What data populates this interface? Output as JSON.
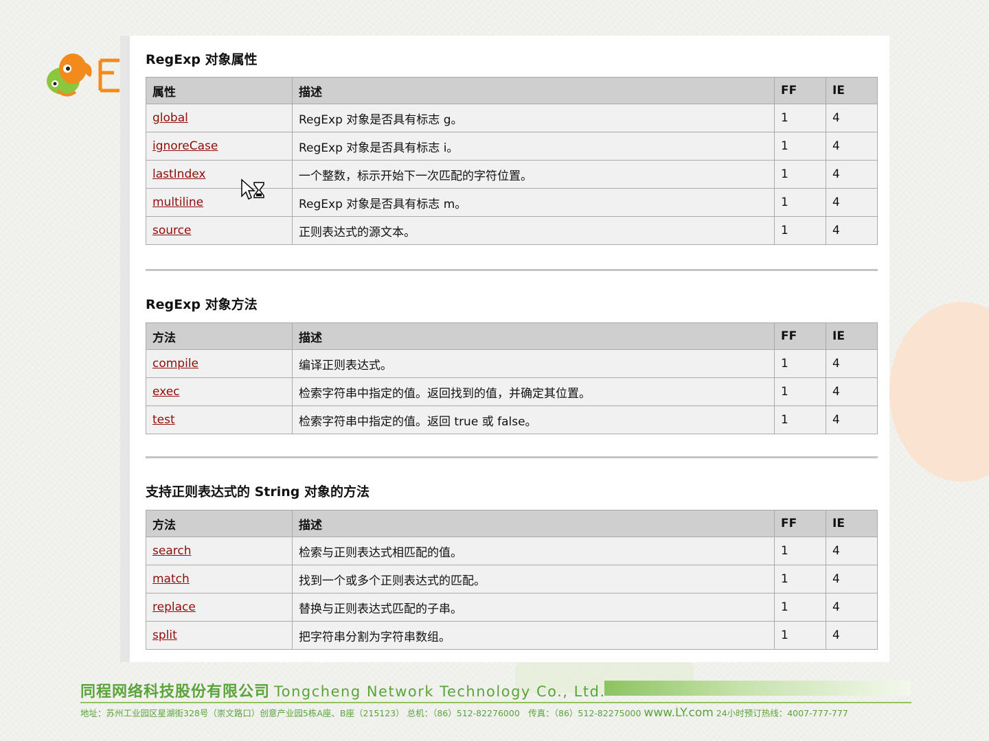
{
  "sections": [
    {
      "title": "RegExp 对象属性",
      "headers": [
        "属性",
        "描述",
        "FF",
        "IE"
      ],
      "rows": [
        {
          "name": "global",
          "desc": "RegExp 对象是否具有标志 g。",
          "ff": "1",
          "ie": "4"
        },
        {
          "name": "ignoreCase",
          "desc": "RegExp 对象是否具有标志 i。",
          "ff": "1",
          "ie": "4"
        },
        {
          "name": "lastIndex",
          "desc": "一个整数，标示开始下一次匹配的字符位置。",
          "ff": "1",
          "ie": "4"
        },
        {
          "name": "multiline",
          "desc": "RegExp 对象是否具有标志 m。",
          "ff": "1",
          "ie": "4"
        },
        {
          "name": "source",
          "desc": "正则表达式的源文本。",
          "ff": "1",
          "ie": "4"
        }
      ]
    },
    {
      "title": "RegExp 对象方法",
      "headers": [
        "方法",
        "描述",
        "FF",
        "IE"
      ],
      "rows": [
        {
          "name": "compile",
          "desc": "编译正则表达式。",
          "ff": "1",
          "ie": "4"
        },
        {
          "name": "exec",
          "desc": "检索字符串中指定的值。返回找到的值，并确定其位置。",
          "ff": "1",
          "ie": "4"
        },
        {
          "name": "test",
          "desc": "检索字符串中指定的值。返回 true 或 false。",
          "ff": "1",
          "ie": "4"
        }
      ]
    },
    {
      "title": "支持正则表达式的 String 对象的方法",
      "headers": [
        "方法",
        "描述",
        "FF",
        "IE"
      ],
      "rows": [
        {
          "name": "search",
          "desc": "检索与正则表达式相匹配的值。",
          "ff": "1",
          "ie": "4"
        },
        {
          "name": "match",
          "desc": "找到一个或多个正则表达式的匹配。",
          "ff": "1",
          "ie": "4"
        },
        {
          "name": "replace",
          "desc": "替换与正则表达式匹配的子串。",
          "ff": "1",
          "ie": "4"
        },
        {
          "name": "split",
          "desc": "把字符串分割为字符串数组。",
          "ff": "1",
          "ie": "4"
        }
      ]
    }
  ],
  "footer": {
    "company_cn": "同程网络科技股份有限公司",
    "company_en": "Tongcheng Network Technology Co., Ltd.",
    "address": "地址：苏州工业园区星湖街328号（崇文路口）创意产业园5栋A座、B座（215123） 总机：（86）512-82276000　传真：（86）512-82275000",
    "website": "www.LY.com",
    "hotline": "24小时预订热线：4007-777-777"
  },
  "icons": {
    "logo": "fish-logo-icon",
    "cursor": "busy-cursor-icon"
  },
  "colors": {
    "link": "#900b09",
    "brand_green": "#5aa43a",
    "logo_orange": "#f28a1c"
  }
}
